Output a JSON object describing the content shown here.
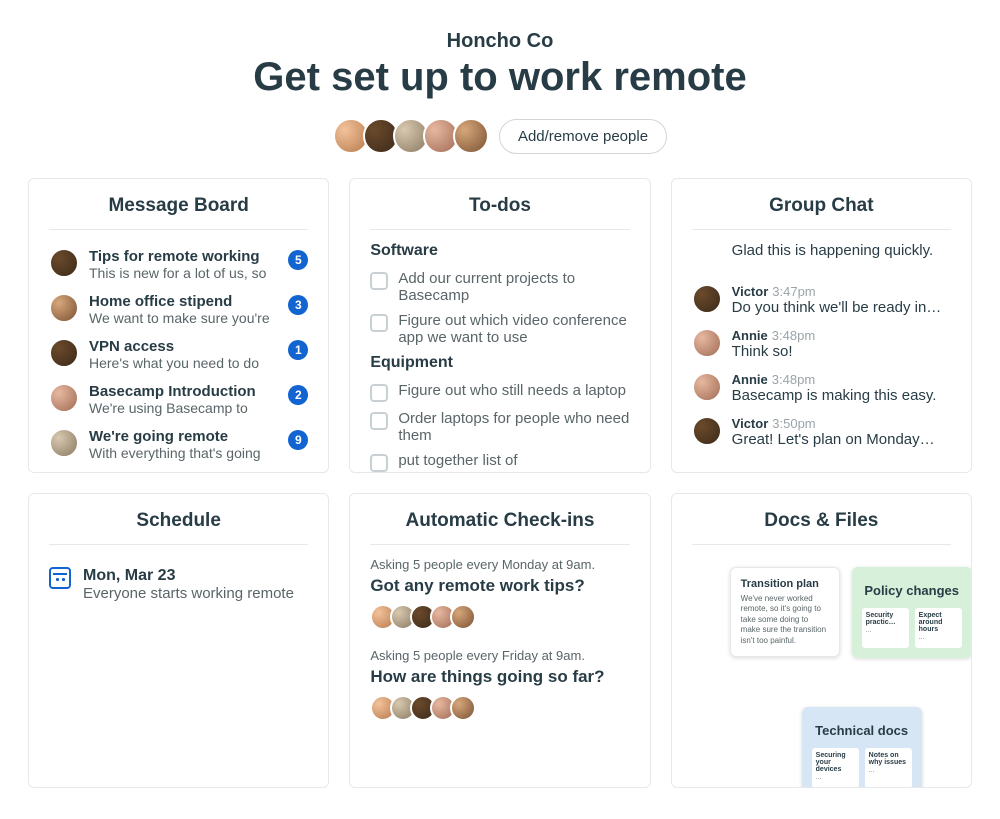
{
  "header": {
    "company": "Honcho Co",
    "title": "Get set up to work remote",
    "button": "Add/remove people"
  },
  "cards": {
    "message_board": {
      "title": "Message Board",
      "items": [
        {
          "title": "Tips for remote working",
          "sub": "This is new for a lot of us, so",
          "count": "5"
        },
        {
          "title": "Home office stipend",
          "sub": "We want to make sure you're",
          "count": "3"
        },
        {
          "title": "VPN access",
          "sub": "Here's what you need to do",
          "count": "1"
        },
        {
          "title": "Basecamp Introduction",
          "sub": "We're using Basecamp to",
          "count": "2"
        },
        {
          "title": "We're going remote",
          "sub": "With everything that's going",
          "count": "9"
        }
      ]
    },
    "todos": {
      "title": "To-dos",
      "groups": [
        {
          "name": "Software",
          "items": [
            "Add our current projects to Basecamp",
            "Figure out which video conference app we want to use"
          ]
        },
        {
          "name": "Equipment",
          "items": [
            "Figure out who still needs a laptop",
            "Order laptops for people who need them",
            "put together list of"
          ]
        }
      ]
    },
    "chat": {
      "title": "Group Chat",
      "lines": [
        {
          "name": "",
          "time": "",
          "text": "Glad this is happening quickly."
        },
        {
          "name": "Victor",
          "time": "3:47pm",
          "text": "Do you think we'll be ready in…"
        },
        {
          "name": "Annie",
          "time": "3:48pm",
          "text": "Think so!"
        },
        {
          "name": "Annie",
          "time": "3:48pm",
          "text": "Basecamp is making this easy."
        },
        {
          "name": "Victor",
          "time": "3:50pm",
          "text": "Great! Let's plan on Monday…"
        }
      ]
    },
    "schedule": {
      "title": "Schedule",
      "date": "Mon, Mar 23",
      "sub": "Everyone starts working remote"
    },
    "checkins": {
      "title": "Automatic Check-ins",
      "blocks": [
        {
          "meta": "Asking 5 people every Monday at 9am.",
          "q": "Got any remote work tips?"
        },
        {
          "meta": "Asking 5 people every Friday at 9am.",
          "q": "How are things going so far?"
        }
      ]
    },
    "docs": {
      "title": "Docs & Files",
      "white": {
        "title": "Transition plan",
        "body": "We've never worked remote, so it's going to take some doing to make sure the transition isn't too painful."
      },
      "green": {
        "title": "Policy changes",
        "chip1": "Security practic…",
        "chip2": "Expect around hours"
      },
      "blue": {
        "title": "Technical docs",
        "chip1": "Securing your devices",
        "chip2": "Notes on why issues"
      }
    }
  }
}
